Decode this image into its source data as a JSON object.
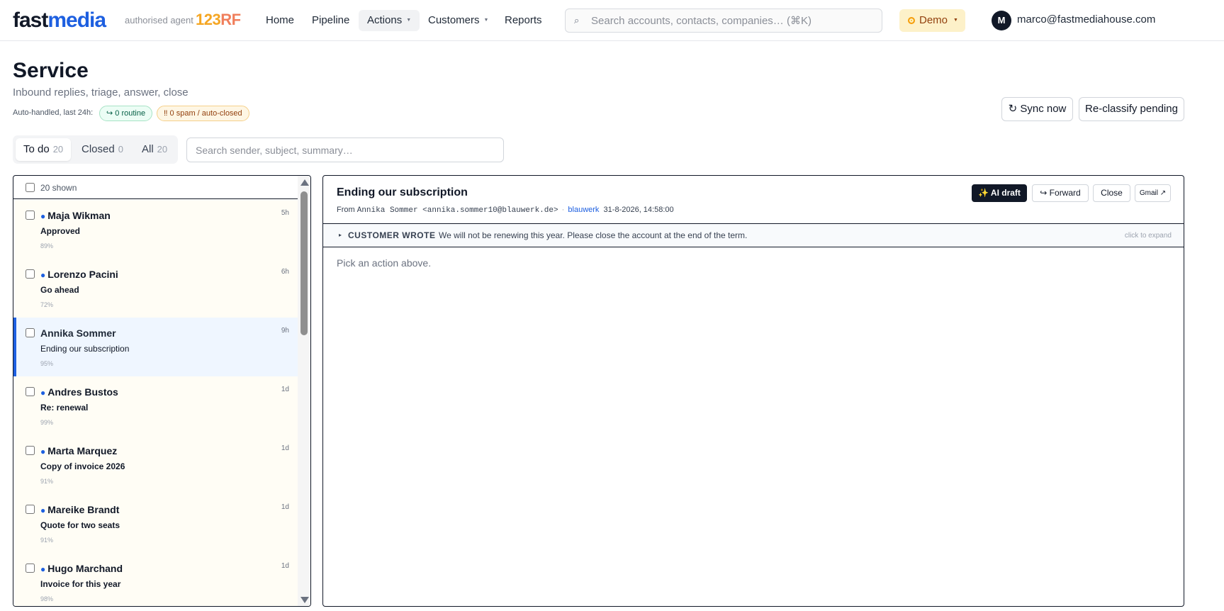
{
  "nav": {
    "brand_part1": "fast",
    "brand_part2": "media",
    "agent_label": "authorised agent",
    "partner_part1": "123",
    "partner_part2": "RF",
    "items": [
      "Home",
      "Pipeline",
      "Actions",
      "Customers",
      "Reports"
    ],
    "search_placeholder": "Search accounts, contacts, companies… (⌘K)",
    "environment": "Demo",
    "avatar_initial": "M",
    "user_email": "marco@fastmediahouse.com"
  },
  "header": {
    "title": "Service",
    "subtitle": "Inbound replies, triage, answer, close",
    "auto_label": "Auto-handled, last 24h:",
    "routine_badge": "↪ 0 routine",
    "spam_badge": "‼ 0 spam / auto-closed",
    "sync_button": "↻ Sync now",
    "reclassify_button": "Re-classify pending"
  },
  "tabs": [
    {
      "label": "To do",
      "count": "20"
    },
    {
      "label": "Closed",
      "count": "0"
    },
    {
      "label": "All",
      "count": "20"
    }
  ],
  "list_search_placeholder": "Search sender, subject, summary…",
  "inbox": {
    "shown_label": "20 shown",
    "unread_marker": "●",
    "rows": [
      {
        "sender": "Maja Wikman",
        "subject": "Approved",
        "confidence": "89%",
        "age": "5h"
      },
      {
        "sender": "Lorenzo Pacini",
        "subject": "Go ahead",
        "confidence": "72%",
        "age": "6h"
      },
      {
        "sender": "Annika Sommer",
        "subject": "Ending our subscription",
        "confidence": "95%",
        "age": "9h"
      },
      {
        "sender": "Andres Bustos",
        "subject": "Re: renewal",
        "confidence": "99%",
        "age": "1d"
      },
      {
        "sender": "Marta Marquez",
        "subject": "Copy of invoice 2026",
        "confidence": "91%",
        "age": "1d"
      },
      {
        "sender": "Mareike Brandt",
        "subject": "Quote for two seats",
        "confidence": "91%",
        "age": "1d"
      },
      {
        "sender": "Hugo Marchand",
        "subject": "Invoice for this year",
        "confidence": "98%",
        "age": "1d"
      }
    ]
  },
  "detail": {
    "subject": "Ending our subscription",
    "from_prefix": "From",
    "from_address": "Annika Sommer <annika.sommer10@blauwerk.de>",
    "separator": "·",
    "company": "blauwerk",
    "datetime": "31-8-2026, 14:58:00",
    "ai_draft_button": "✨ AI draft",
    "forward_button": "↪ Forward",
    "close_button": "Close",
    "gmail_button": "Gmail ↗",
    "quote_marker": "▸",
    "quote_label": "CUSTOMER WROTE",
    "quote_text": "We will not be renewing this year. Please close the account at the end of the term.",
    "quote_hint": "click to expand",
    "empty_state": "Pick an action above."
  }
}
